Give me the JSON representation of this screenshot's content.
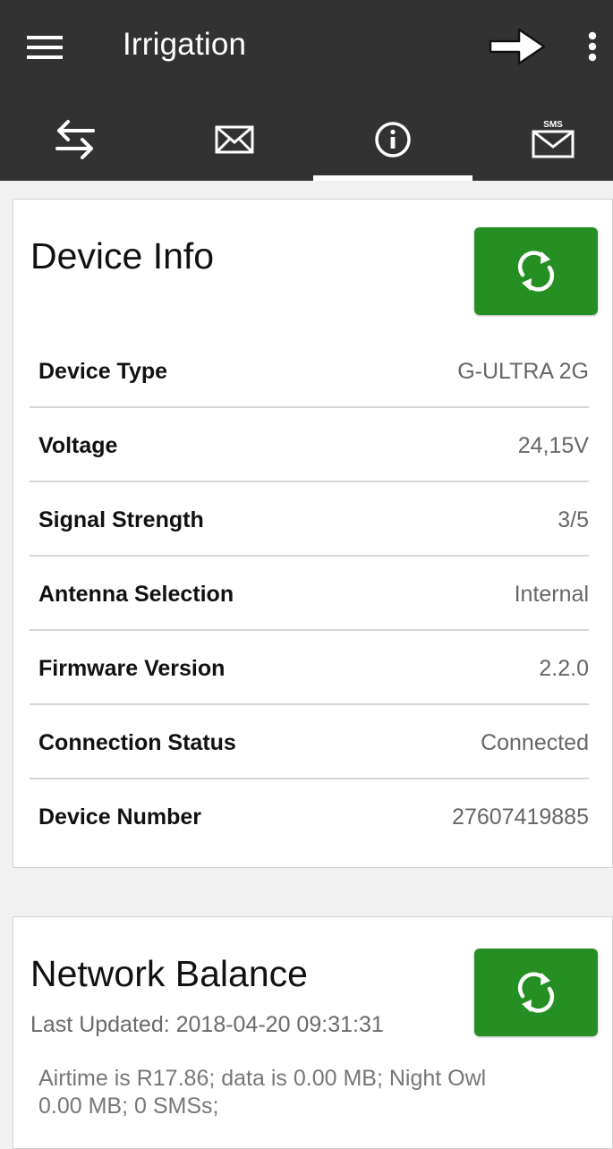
{
  "app_bar": {
    "title": "Irrigation",
    "icons": [
      "menu-icon",
      "arrow-right-icon",
      "more-vert-icon"
    ]
  },
  "tabs": [
    {
      "icon": "swap-arrows-icon"
    },
    {
      "icon": "mail-icon"
    },
    {
      "icon": "info-icon",
      "selected": true
    },
    {
      "icon": "sms-icon",
      "badge": "SMS"
    }
  ],
  "device_info": {
    "title": "Device Info",
    "refresh_icon": "refresh-icon",
    "rows": [
      {
        "label": "Device Type",
        "value": "G-ULTRA 2G"
      },
      {
        "label": "Voltage",
        "value": "24,15V"
      },
      {
        "label": "Signal Strength",
        "value": "3/5"
      },
      {
        "label": "Antenna Selection",
        "value": "Internal"
      },
      {
        "label": "Firmware Version",
        "value": "2.2.0"
      },
      {
        "label": "Connection Status",
        "value": "Connected"
      },
      {
        "label": "Device Number",
        "value": "27607419885"
      }
    ]
  },
  "network_balance": {
    "title": "Network Balance",
    "last_updated": "Last Updated: 2018-04-20 09:31:31",
    "details": "Airtime is R17.86; data is 0.00 MB; Night Owl\n0.00 MB;  0 SMSs;",
    "refresh_icon": "refresh-icon"
  },
  "colors": {
    "toolbar": "#323232",
    "accent_green": "#268f24",
    "background": "#f1f1f1",
    "card": "#ffffff"
  }
}
